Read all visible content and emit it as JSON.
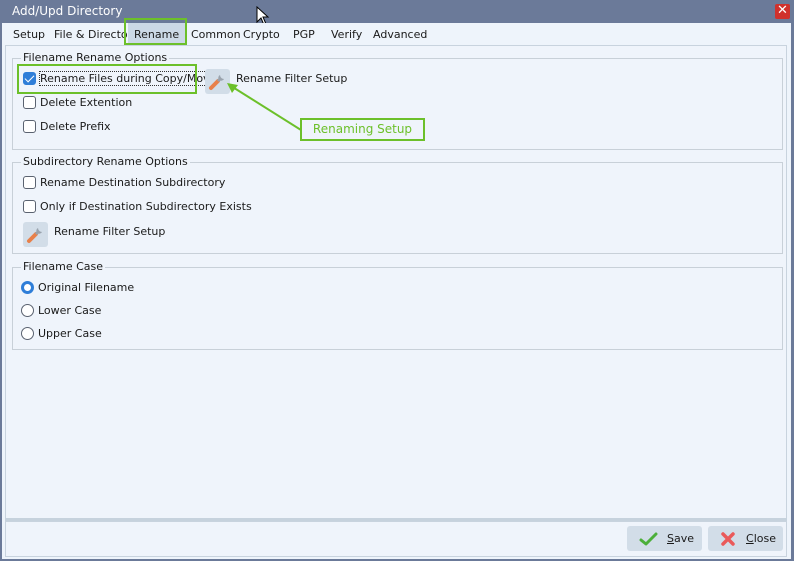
{
  "window": {
    "title": "Add/Upd Directory",
    "close_glyph": "✕"
  },
  "tabs": [
    {
      "label": "Setup",
      "active": false
    },
    {
      "label": "File & Directory",
      "active": false
    },
    {
      "label": "Rename",
      "active": true
    },
    {
      "label": "Common",
      "active": false
    },
    {
      "label": "Crypto",
      "active": false
    },
    {
      "label": "PGP",
      "active": false
    },
    {
      "label": "Verify",
      "active": false
    },
    {
      "label": "Advanced",
      "active": false
    }
  ],
  "filename_rename": {
    "label": "Filename Rename Options",
    "rename_files": {
      "label": "Rename Files during Copy/Move",
      "checked": true
    },
    "delete_extension": {
      "label": "Delete Extention",
      "checked": false
    },
    "delete_prefix": {
      "label": "Delete Prefix",
      "checked": false
    },
    "filter_setup_label": "Rename Filter Setup",
    "filter_icon": "wrench-icon"
  },
  "subdirectory_rename": {
    "label": "Subdirectory Rename Options",
    "rename_destination": {
      "label": "Rename Destination Subdirectory",
      "checked": false
    },
    "only_if_exists": {
      "label": "Only if Destination Subdirectory Exists",
      "checked": false
    },
    "filter_setup_label": "Rename Filter Setup",
    "filter_icon": "wrench-icon"
  },
  "filename_case": {
    "label": "Filename Case",
    "options": [
      {
        "label": "Original Filename",
        "selected": true
      },
      {
        "label": "Lower Case",
        "selected": false
      },
      {
        "label": "Upper Case",
        "selected": false
      }
    ]
  },
  "annotation": {
    "callout_text": "Renaming Setup",
    "color": "#6cc02a"
  },
  "footer": {
    "save": {
      "mnemonic": "S",
      "rest": "ave",
      "icon": "checkmark-icon"
    },
    "close": {
      "mnemonic": "C",
      "rest": "lose",
      "icon": "x-icon"
    }
  }
}
